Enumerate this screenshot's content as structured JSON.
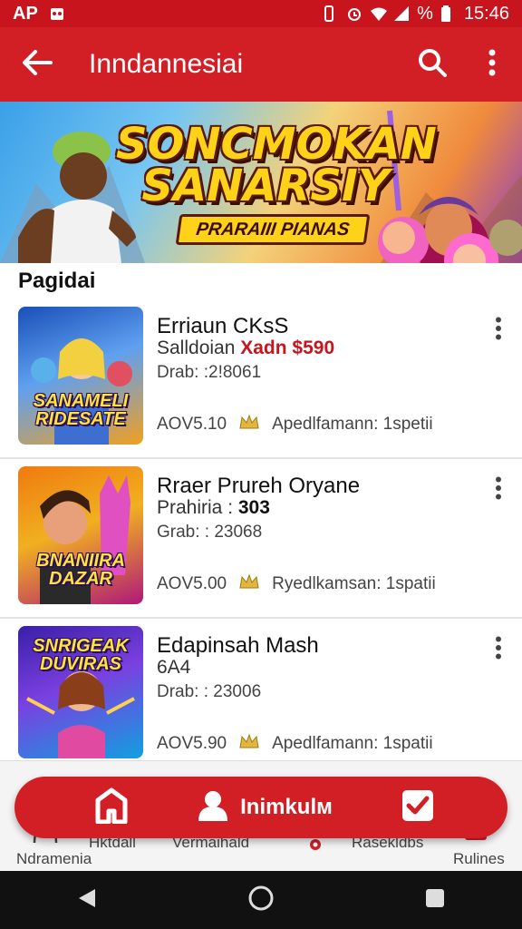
{
  "status_bar": {
    "left_text": "AP",
    "battery_text": "%",
    "time": "15:46"
  },
  "app_bar": {
    "title": "Inndannesiai",
    "back_icon": "arrow-left-icon",
    "search_icon": "search-icon",
    "more_icon": "more-vertical-icon"
  },
  "banner": {
    "title_line1": "SONCMOKAN",
    "title_line2": "SANARSIY",
    "subtitle": "PRARAIII PIANAS"
  },
  "section": {
    "title": "Pagidai"
  },
  "items": [
    {
      "title": "Erriaun CKsS",
      "sub_label": "Salldoian",
      "price": "Xadn $590",
      "line3": "Drab: :2!8061",
      "version": "AOV5.10",
      "meta": "Apedlfamann: 1spetii",
      "thumb_caption": "SANAMELI RIDESATE",
      "thumb_colors": [
        "#1a4fb8",
        "#f0a020"
      ]
    },
    {
      "title": "Rraer Prureh Oryane",
      "sub_label": "Prahiria : ",
      "sub_value": "303",
      "line3": "Grab: : 23068",
      "version": "AOV5.00",
      "meta": "Ryedlkamsan: 1spatii",
      "thumb_caption": "BNANIIRA DAZAR",
      "thumb_colors": [
        "#f07a10",
        "#b01878"
      ]
    },
    {
      "title": "Edapinsah Mash",
      "sub_label": "6A4",
      "line3": "Drab: : 23006",
      "version": "AOV5.90",
      "meta": "Apedlfamann: 1spatii",
      "thumb_caption": "SNRIGEAK DUVIRAS",
      "thumb_colors": [
        "#3a1fa8",
        "#10a0e0"
      ]
    }
  ],
  "bottom_nav": {
    "labels": [
      "Ndramenia",
      "Hktdall",
      "Vermaihald",
      "Rasekldbs",
      "Rulines"
    ],
    "fab_label": "Inimkulм"
  },
  "colors": {
    "primary": "#d21f26",
    "status": "#c8141d",
    "price": "#c8141d",
    "crown": "#e0b840"
  }
}
